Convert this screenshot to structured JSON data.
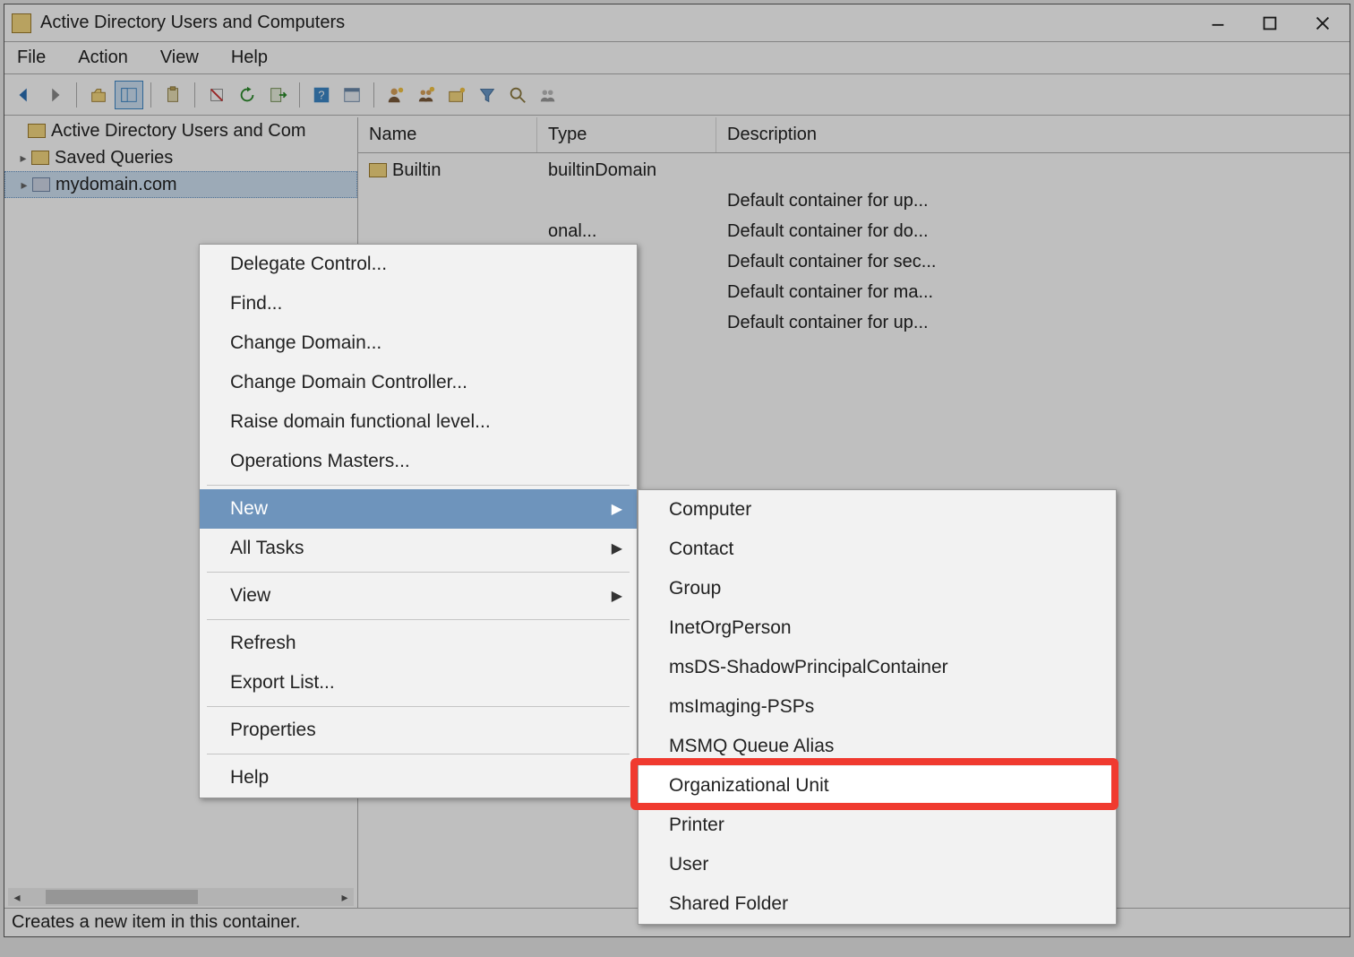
{
  "titlebar": {
    "title": "Active Directory Users and Computers",
    "minimize_tip": "Minimize",
    "maximize_tip": "Maximize",
    "close_tip": "Close"
  },
  "menubar": {
    "items": [
      "File",
      "Action",
      "View",
      "Help"
    ]
  },
  "toolbar": {
    "back_tip": "Back",
    "forward_tip": "Forward",
    "up_tip": "Up one level",
    "showhide_tip": "Show/Hide Console Tree",
    "cut_tip": "Cut",
    "copy_tip": "Copy",
    "refresh_tip": "Refresh",
    "export_tip": "Export List",
    "help_tip": "Help",
    "props_tip": "Properties",
    "adduser_tip": "Create a new user",
    "addgroup_tip": "Create a new group",
    "addou_tip": "Create a new OU",
    "filter_tip": "Filter options",
    "find_tip": "Find objects",
    "member_tip": "Add to group"
  },
  "tree": {
    "root": "Active Directory Users and Com",
    "saved_queries": "Saved Queries",
    "domain": "mydomain.com"
  },
  "list": {
    "columns": {
      "name": "Name",
      "type": "Type",
      "description": "Description"
    },
    "rows": [
      {
        "name": "Builtin",
        "type": "builtinDomain",
        "description": ""
      },
      {
        "name": "",
        "type": "",
        "description": "Default container for up..."
      },
      {
        "name": "",
        "type": "onal...",
        "description": "Default container for do..."
      },
      {
        "name": "",
        "type": "",
        "description": "Default container for sec..."
      },
      {
        "name": "",
        "type": "",
        "description": "Default container for ma..."
      },
      {
        "name": "",
        "type": "",
        "description": "Default container for up..."
      }
    ]
  },
  "statusbar": {
    "text": "Creates a new item in this container."
  },
  "context1": {
    "items": [
      {
        "label": "Delegate Control...",
        "type": "item"
      },
      {
        "label": "Find...",
        "type": "item"
      },
      {
        "label": "Change Domain...",
        "type": "item"
      },
      {
        "label": "Change Domain Controller...",
        "type": "item"
      },
      {
        "label": "Raise domain functional level...",
        "type": "item"
      },
      {
        "label": "Operations Masters...",
        "type": "item"
      },
      {
        "type": "sep"
      },
      {
        "label": "New",
        "type": "submenu",
        "selected": true
      },
      {
        "label": "All Tasks",
        "type": "submenu"
      },
      {
        "type": "sep"
      },
      {
        "label": "View",
        "type": "submenu"
      },
      {
        "type": "sep"
      },
      {
        "label": "Refresh",
        "type": "item"
      },
      {
        "label": "Export List...",
        "type": "item"
      },
      {
        "type": "sep"
      },
      {
        "label": "Properties",
        "type": "item"
      },
      {
        "type": "sep"
      },
      {
        "label": "Help",
        "type": "item"
      }
    ]
  },
  "context2": {
    "items": [
      {
        "label": "Computer"
      },
      {
        "label": "Contact"
      },
      {
        "label": "Group"
      },
      {
        "label": "InetOrgPerson"
      },
      {
        "label": "msDS-ShadowPrincipalContainer"
      },
      {
        "label": "msImaging-PSPs"
      },
      {
        "label": "MSMQ Queue Alias"
      },
      {
        "label": "Organizational Unit",
        "highlight": true
      },
      {
        "label": "Printer"
      },
      {
        "label": "User"
      },
      {
        "label": "Shared Folder"
      }
    ]
  }
}
